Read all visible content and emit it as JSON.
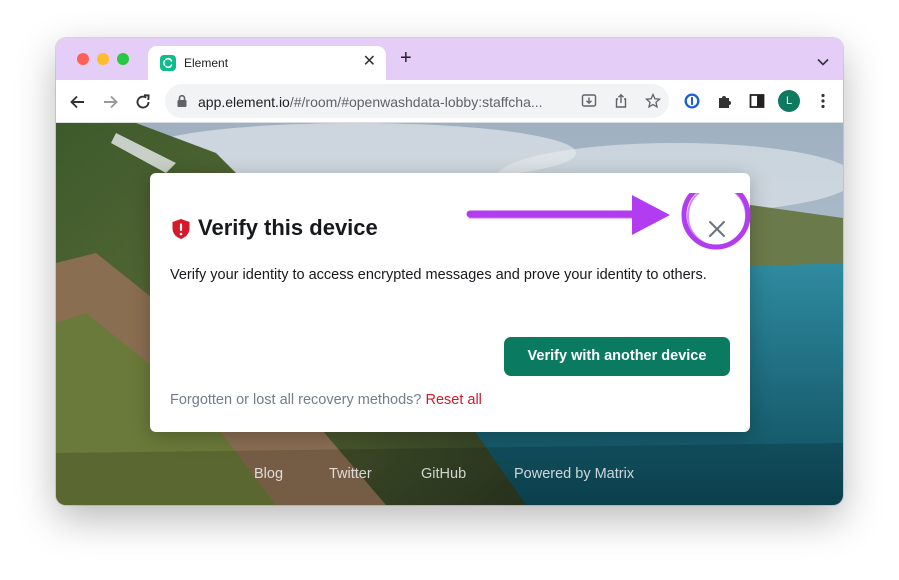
{
  "browser": {
    "tab": {
      "title": "Element",
      "close_glyph": "✕"
    },
    "new_tab_glyph": "+",
    "url": {
      "host": "app.element.io",
      "path": "/#/room/#openwashdata-lobby:staffcha..."
    },
    "profile_initial": "L",
    "icons": [
      "back-icon",
      "forward-icon",
      "reload-icon",
      "lock-icon",
      "install-icon",
      "share-icon",
      "star-icon",
      "password-manager-icon",
      "extensions-icon",
      "sidepanel-icon",
      "more-icon"
    ]
  },
  "dialog": {
    "title": "Verify this device",
    "body": "Verify your identity to access encrypted messages and prove your identity to others.",
    "verify_button": "Verify with another device",
    "footer_text": "Forgotten or lost all recovery methods? ",
    "reset_link": "Reset all"
  },
  "footer_links": {
    "blog": "Blog",
    "twitter": "Twitter",
    "github": "GitHub",
    "matrix": "Powered by Matrix"
  },
  "colors": {
    "tabbar": "#e4cdf7",
    "element_green": "#0dbd8b",
    "button_green": "#0a7a60",
    "danger_red": "#d51928",
    "annotation_purple": "#b23cf0"
  }
}
